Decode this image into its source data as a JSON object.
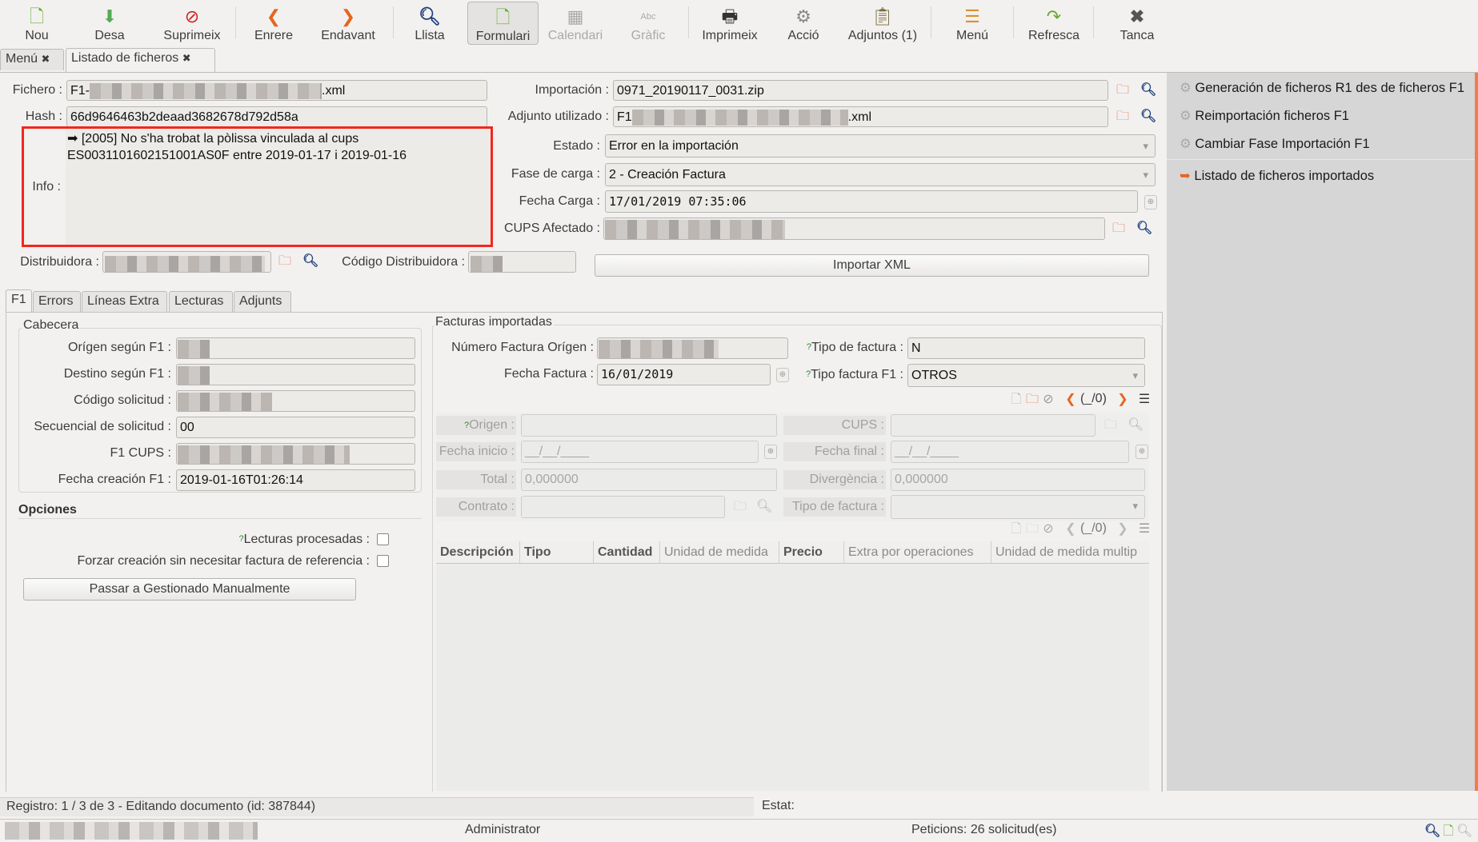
{
  "toolbar": {
    "items": [
      {
        "label": "Nou",
        "icon": "new-document-icon"
      },
      {
        "label": "Desa",
        "icon": "save-icon"
      },
      {
        "label": "Suprimeix",
        "icon": "delete-icon"
      },
      {
        "label": "Enrere",
        "icon": "previous-icon"
      },
      {
        "label": "Endavant",
        "icon": "next-icon"
      },
      {
        "label": "Llista",
        "icon": "search-icon"
      },
      {
        "label": "Formulari",
        "icon": "form-icon"
      },
      {
        "label": "Calendari",
        "icon": "calendar-icon"
      },
      {
        "label": "Gràfic",
        "icon": "graph-icon"
      },
      {
        "label": "Imprimeix",
        "icon": "print-icon"
      },
      {
        "label": "Acció",
        "icon": "gears-icon"
      },
      {
        "label": "Adjuntos (1)",
        "icon": "attachment-icon"
      },
      {
        "label": "Menú",
        "icon": "menu-icon"
      },
      {
        "label": "Refresca",
        "icon": "refresh-icon"
      },
      {
        "label": "Tanca",
        "icon": "close-icon"
      }
    ]
  },
  "tabs": [
    {
      "label": "Menú"
    },
    {
      "label": "Listado de ficheros"
    }
  ],
  "form": {
    "fichero": {
      "label": "Fichero :",
      "prefix": "F1-",
      "suffix": ".xml"
    },
    "hash": {
      "label": "Hash :",
      "value": "66d9646463b2deaad3682678d792d58a"
    },
    "info": {
      "label": "Info :",
      "line1": "➡ [2005] No s'ha trobat la pòlissa vinculada al cups",
      "line2": "ES0031101602151001AS0F entre 2019-01-17 i 2019-01-16"
    },
    "importacion": {
      "label": "Importación :",
      "value": "0971_20190117_0031.zip"
    },
    "adjunto": {
      "label": "Adjunto utilizado :",
      "prefix": "F1",
      "suffix": ".xml"
    },
    "estado": {
      "label": "Estado :",
      "value": "Error en la importación"
    },
    "fase": {
      "label": "Fase de carga :",
      "value": "2 - Creación Factura"
    },
    "fecha_carga": {
      "label": "Fecha Carga :",
      "value": "17/01/2019 07:35:06"
    },
    "cups_afectado": {
      "label": "CUPS Afectado :"
    },
    "distribuidora": {
      "label": "Distribuidora :"
    },
    "codigo_distribuidora": {
      "label": "Código Distribuidora :"
    },
    "importar_xml": "Importar XML"
  },
  "right_panel": {
    "accent": "#f07c4a",
    "actions": [
      "Generación de ficheros R1 des de ficheros F1",
      "Reimportación ficheros F1",
      "Cambiar Fase Importación F1"
    ],
    "relate": "Listado de ficheros importados"
  },
  "notebook": {
    "tabs": [
      {
        "label": "F1"
      },
      {
        "label": "Errors"
      },
      {
        "label": "Líneas Extra"
      },
      {
        "label": "Lecturas"
      },
      {
        "label": "Adjunts"
      }
    ],
    "cabecera": {
      "title": "Cabecera",
      "origen": "Orígen según F1 :",
      "destino": "Destino según F1 :",
      "codigo": "Código solicitud :",
      "secuencial": {
        "label": "Secuencial de solicitud :",
        "value": "00"
      },
      "cups": "F1 CUPS :",
      "fecha_creacion": {
        "label": "Fecha creación F1 :",
        "value": "2019-01-16T01:26:14"
      }
    },
    "opciones": {
      "title": "Opciones",
      "lecturas": {
        "label": "Lecturas procesadas :",
        "checked": false
      },
      "forzar": {
        "label": "Forzar creación sin necesitar factura de referencia :",
        "checked": false
      },
      "passar": "Passar a Gestionado Manualmente"
    },
    "facturas": {
      "title": "Facturas importadas",
      "numero": "Número Factura Orígen :",
      "tipo_factura": {
        "label": "Tipo de factura :",
        "value": "N"
      },
      "fecha_factura": {
        "label": "Fecha Factura :",
        "value": "16/01/2019"
      },
      "tipo_f1": {
        "label": "Tipo factura F1 :",
        "value": "OTROS"
      },
      "pager": "(_/0)",
      "origen": "Origen :",
      "cups": "CUPS :",
      "fecha_inicio": {
        "label": "Fecha inicio :",
        "value": "__/__/____"
      },
      "fecha_final": {
        "label": "Fecha final :",
        "value": "__/__/____"
      },
      "total": {
        "label": "Total :",
        "value": "0,000000"
      },
      "divergencia": {
        "label": "Divergència :",
        "value": "0,000000"
      },
      "contrato": "Contrato :",
      "tipo_factura2": "Tipo de factura :",
      "pager2": "(_/0)",
      "columns": [
        "Descripción",
        "Tipo",
        "Cantidad",
        "Unidad de medida",
        "Precio",
        "Extra por operaciones",
        "Unidad de medida multip"
      ]
    }
  },
  "status": {
    "registro": "Registro: 1 / 3 de 3 - Editando documento (id: 387844)",
    "estat": "Estat:"
  },
  "footer": {
    "user": "Administrator",
    "requests": "Peticions:  26 solicitud(es)"
  }
}
